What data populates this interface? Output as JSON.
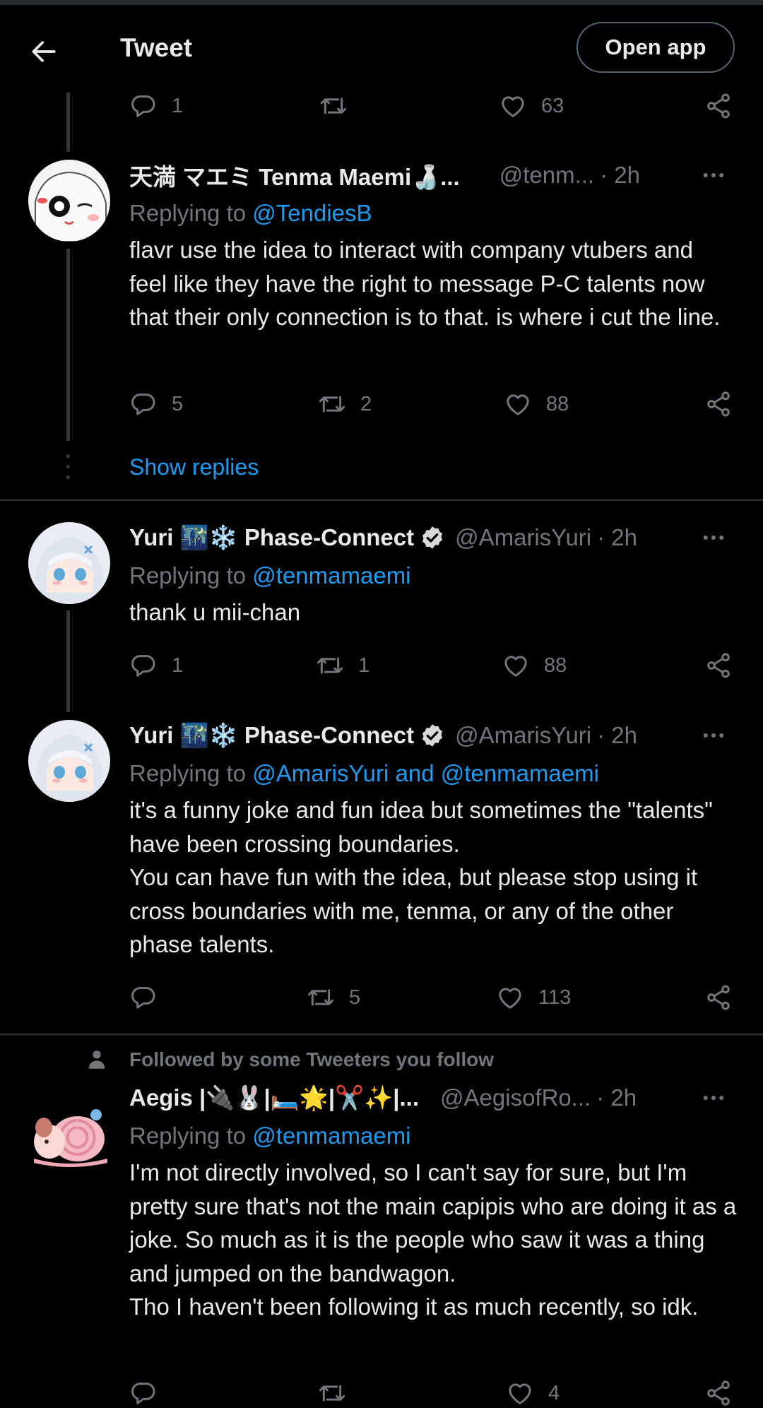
{
  "header": {
    "title": "Tweet",
    "open_app_label": "Open app"
  },
  "top_actions": {
    "replies": "1",
    "retweets": "",
    "likes": "63"
  },
  "tweet1": {
    "name": "天満 マエミ Tenma Maemi🍶...",
    "handle": "@tenm...",
    "time": "· 2h",
    "replying_prefix": "Replying to",
    "replying_to": "@TendiesB",
    "text": "flavr use the idea to interact with company vtubers and feel like they have the right to message P-C talents now that their only connection is to that. is where i cut the line.",
    "replies": "5",
    "retweets": "2",
    "likes": "88",
    "show_replies": "Show replies"
  },
  "tweet2": {
    "name": "Yuri 🌃❄️ Phase-Connect",
    "handle": "@AmarisYuri",
    "time": "· 2h",
    "replying_prefix": "Replying to",
    "replying_to": "@tenmamaemi",
    "text": "thank u mii-chan",
    "replies": "1",
    "retweets": "1",
    "likes": "88"
  },
  "tweet3": {
    "name": "Yuri 🌃❄️ Phase-Connect",
    "handle": "@AmarisYuri",
    "time": "· 2h",
    "replying_prefix": "Replying to",
    "replying_to": "@AmarisYuri and @tenmamaemi",
    "text_line1": "it's a funny joke and fun idea but sometimes the \"talents\" have been crossing boundaries.",
    "text_line2": "You can have fun with the idea, but please stop using it cross boundaries with me, tenma, or any of the other phase talents.",
    "replies": "",
    "retweets": "5",
    "likes": "113"
  },
  "tweet4": {
    "social_context": "Followed by some Tweeters you follow",
    "name": "Aegis |🔌🐰|🛏️🌟|✂️✨|...",
    "handle": "@AegisofRo...",
    "time": "· 2h",
    "replying_prefix": "Replying to",
    "replying_to": "@tenmamaemi",
    "text_line1": "I'm not directly involved, so I can't say for sure, but I'm pretty sure that's not the main capipis who are doing it as a joke. So much as it is the people who saw it was a thing and jumped on the bandwagon.",
    "text_line2": "Tho I haven't been following it as much recently, so idk.",
    "replies": "",
    "retweets": "",
    "likes": "4"
  },
  "colors": {
    "background": "#000000",
    "accent": "#1d9bf0",
    "muted": "#71767b",
    "text": "#e7e9ea"
  },
  "icons": {
    "back": "arrow-left-icon",
    "reply": "reply-icon",
    "retweet": "retweet-icon",
    "like": "heart-icon",
    "share": "share-icon",
    "more": "more-icon",
    "verified": "verified-badge-icon"
  }
}
